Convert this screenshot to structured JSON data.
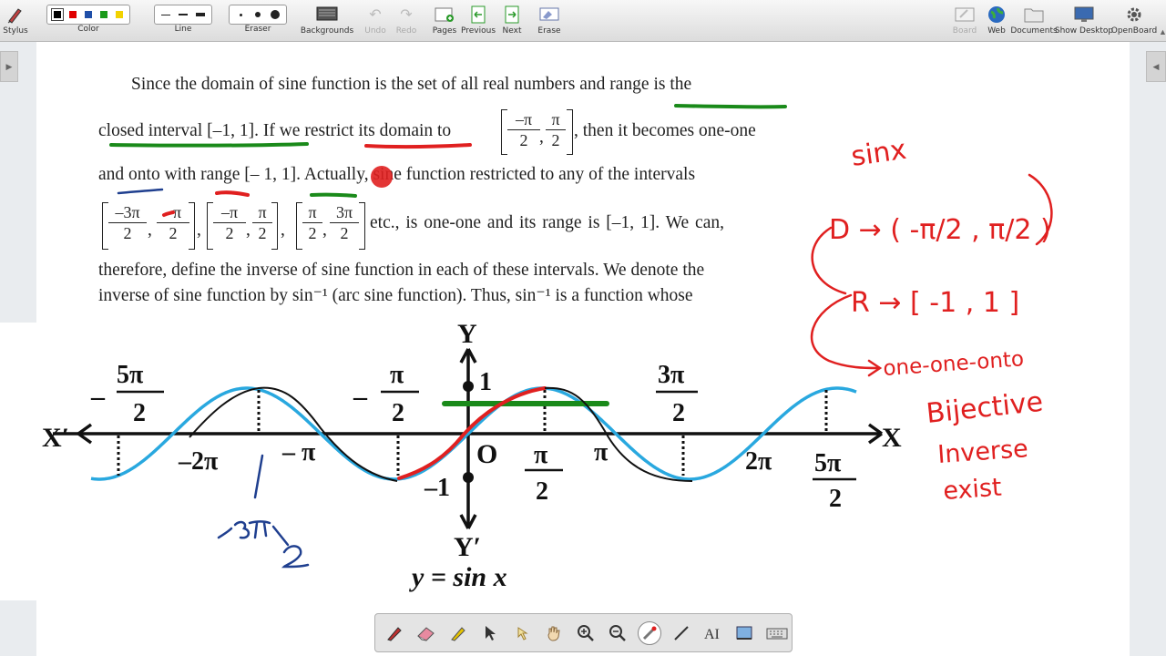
{
  "toolbar": {
    "stylus": "Stylus",
    "color": "Color",
    "line": "Line",
    "eraser": "Eraser",
    "backgrounds": "Backgrounds",
    "undo": "Undo",
    "redo": "Redo",
    "pages": "Pages",
    "previous": "Previous",
    "next": "Next",
    "erase": "Erase",
    "board": "Board",
    "web": "Web",
    "documents": "Documents",
    "show_desktop": "Show Desktop",
    "openboard": "OpenBoard",
    "colors": [
      "#000000",
      "#e00000",
      "#1f4fa8",
      "#1a9a1a",
      "#f2d200"
    ]
  },
  "text": {
    "p1_line1": "Since the domain of sine function is the set of all real numbers and range is the",
    "p1_line2a": "closed interval [–1, 1]. If we restrict its domain to",
    "p1_line2b": ", then it becomes one-one",
    "p1_line3": "and onto with range [– 1, 1]. Actually, sine function restricted to any of the intervals",
    "p1_line4": "etc., is one-one and its range is [–1, 1]. We can,",
    "p1_line5": "therefore, define the inverse of sine function in each of these intervals. We denote the",
    "p1_line6": "inverse of sine function by sin⁻¹ (arc sine function). Thus, sin⁻¹ is a function whose",
    "frac_neg_pi": "–π",
    "frac_pi": "π",
    "frac_neg_3pi": "–3π",
    "frac_3pi": "3π",
    "frac_den": "2",
    "comma": ","
  },
  "graph": {
    "y_axis": "Y",
    "y_axis_neg": "Y′",
    "x_axis": "X",
    "x_axis_neg": "X′",
    "origin": "O",
    "one": "1",
    "neg_one": "–1",
    "neg_2pi": "–2π",
    "neg_pi": "– π",
    "pi": "π",
    "two_pi": "2π",
    "neg_5pi_num": "5π",
    "neg_sign": "–",
    "neg_pi2_num": "π",
    "pi2_num": "π",
    "three_pi2_num": "3π",
    "five_pi2_num": "5π",
    "den": "2",
    "caption": "y = sin x"
  },
  "notes": {
    "sinx": "sinx",
    "domain": "D → ( -π/2 , π/2 )",
    "range": "R → [ -1 , 1 ]",
    "one_one": "one-one-onto",
    "bijective": "Bijective",
    "inverse": "Inverse",
    "exist": "exist",
    "neg3pi2": "-3π/2"
  },
  "floatbar": {
    "tools": [
      "pen-icon",
      "eraser-icon",
      "highlighter-icon",
      "pointer-icon",
      "play-icon",
      "hand-icon",
      "zoom-in-icon",
      "zoom-out-icon",
      "laser-icon",
      "line-icon",
      "text-icon",
      "capture-icon",
      "keyboard-icon"
    ]
  },
  "colors": {
    "curve": "#29a8df",
    "red_ink": "#e02020",
    "green_ink": "#1a8a1a",
    "blue_ink": "#1f3f8f"
  }
}
